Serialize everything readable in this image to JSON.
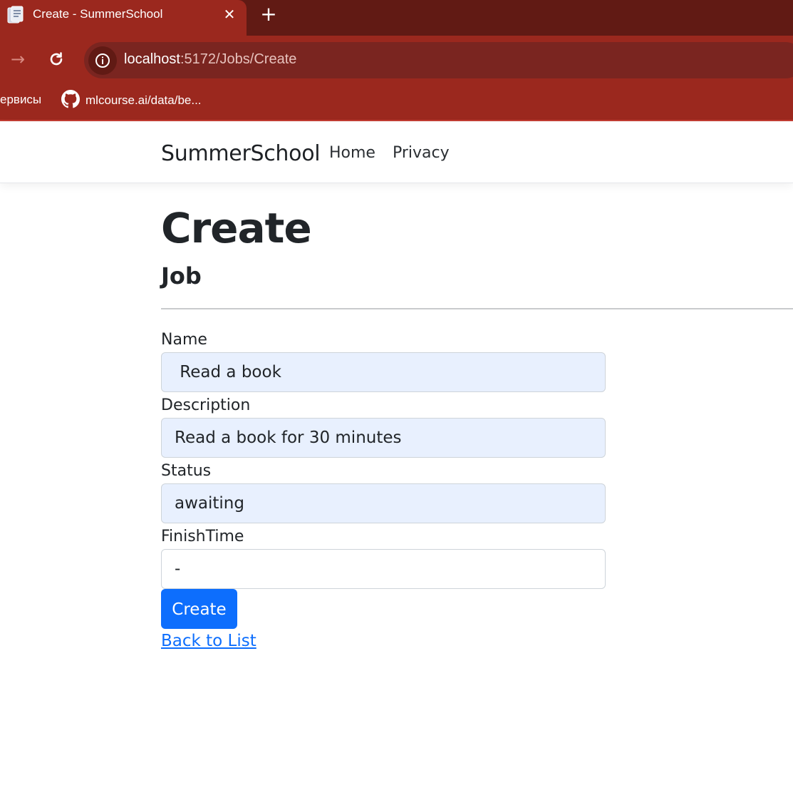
{
  "browser": {
    "tab": {
      "title": "Create - SummerSchool",
      "favicon_icon": "document-icon",
      "close_icon": "close-icon"
    },
    "new_tab_icon": "plus-icon",
    "nav": {
      "forward_icon": "arrow-right-icon",
      "reload_icon": "reload-icon"
    },
    "address_bar": {
      "site_info_icon": "info-icon",
      "host": "localhost",
      "rest": ":5172/Jobs/Create"
    },
    "bookmarks": [
      {
        "label": "ервисы"
      },
      {
        "icon": "github-icon",
        "label": "mlcourse.ai/data/be..."
      }
    ],
    "colors": {
      "chrome_dark": "#611a14",
      "chrome": "#9b281e",
      "omnibox": "#7a2520"
    }
  },
  "navbar": {
    "brand": "SummerSchool",
    "links": [
      "Home",
      "Privacy"
    ]
  },
  "page": {
    "title": "Create",
    "subtitle": "Job"
  },
  "form": {
    "fields": [
      {
        "label": "Name",
        "value": " Read a book",
        "autofilled": true
      },
      {
        "label": "Description",
        "value": "Read a book for 30 minutes",
        "autofilled": true
      },
      {
        "label": "Status",
        "value": "awaiting",
        "autofilled": true
      },
      {
        "label": "FinishTime",
        "value": "-",
        "autofilled": false
      }
    ],
    "submit_label": "Create",
    "back_link": "Back to List",
    "colors": {
      "primary": "#0d6efd",
      "autofill_bg": "#e8f0fe"
    }
  }
}
